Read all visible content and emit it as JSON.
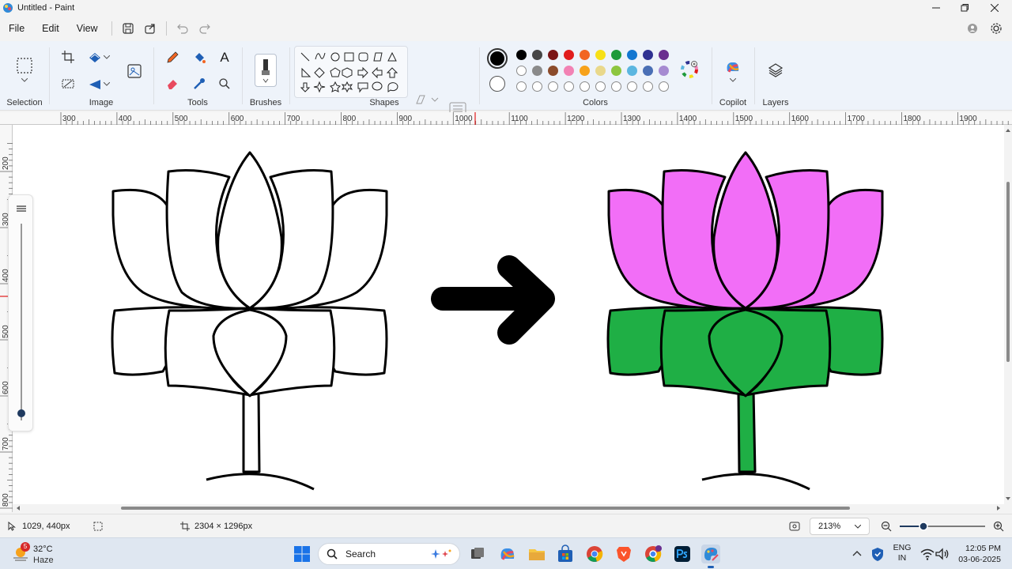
{
  "app": {
    "title": "Untitled - Paint"
  },
  "menu": {
    "file": "File",
    "edit": "Edit",
    "view": "View"
  },
  "ribbon": {
    "selection_label": "Selection",
    "image_label": "Image",
    "tools_label": "Tools",
    "text_tool_glyph": "A",
    "brushes_label": "Brushes",
    "shapes_label": "Shapes",
    "colors_label": "Colors",
    "copilot_label": "Copilot",
    "layers_label": "Layers",
    "palette_row1": [
      "#000000",
      "#464646",
      "#7a1416",
      "#e11d1d",
      "#f26522",
      "#f7e017",
      "#1e9a3a",
      "#1377d1",
      "#2e3192",
      "#6a2f8f"
    ],
    "palette_row2": [
      "#ffffff",
      "#8a8a8a",
      "#8b4b2b",
      "#f282b4",
      "#f7a21b",
      "#e9d88b",
      "#8dc63f",
      "#5bb6e0",
      "#4a6fb5",
      "#a68bd1"
    ],
    "primary_color": "#000000",
    "secondary_color": "#ffffff"
  },
  "ruler": {
    "top_labels": [
      "300",
      "400",
      "500",
      "600",
      "700",
      "800",
      "900",
      "1000",
      "1100",
      "1200",
      "1300",
      "1400",
      "1500",
      "1600",
      "1700",
      "1800",
      "1900"
    ],
    "left_labels": [
      "200",
      "300",
      "400",
      "500",
      "600",
      "700",
      "800"
    ]
  },
  "canvas": {
    "petal_color": "#f26ef7",
    "leaf_color": "#1faf45",
    "outline_color": "#000000"
  },
  "status": {
    "cursor_pos": "1029, 440px",
    "canvas_size": "2304 × 1296px",
    "zoom": "213%"
  },
  "taskbar": {
    "temperature": "32°C",
    "weather": "Haze",
    "weather_badge": "5",
    "search_placeholder": "Search",
    "lang_top": "ENG",
    "lang_bottom": "IN",
    "time": "12:05 PM",
    "date": "03-06-2025"
  }
}
